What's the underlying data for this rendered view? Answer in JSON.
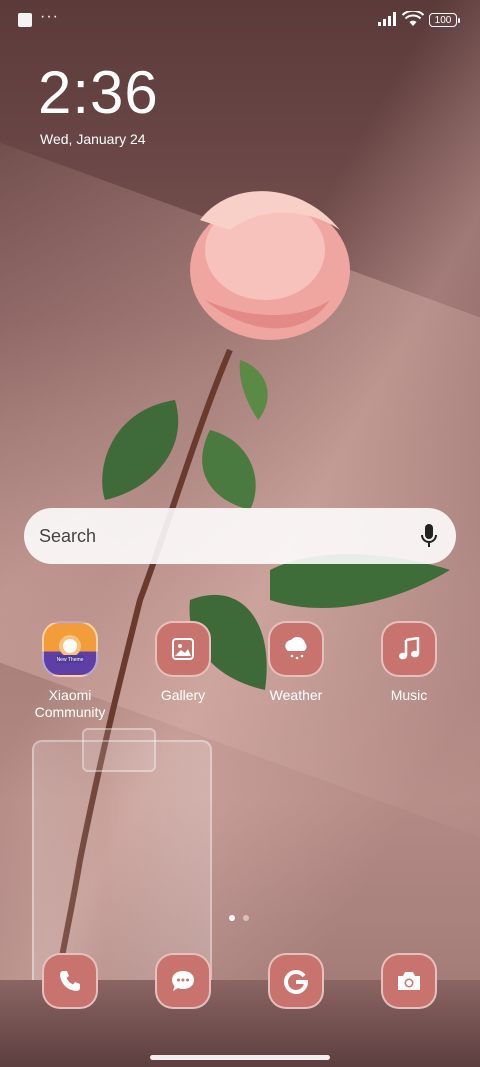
{
  "status": {
    "battery": "100",
    "dots": "···"
  },
  "clock": {
    "time": "2:36",
    "date": "Wed, January 24"
  },
  "search": {
    "placeholder": "Search"
  },
  "apps": [
    {
      "name": "Xiaomi Community",
      "icon": "xiaomi-community-icon"
    },
    {
      "name": "Gallery",
      "icon": "gallery-icon"
    },
    {
      "name": "Weather",
      "icon": "weather-icon"
    },
    {
      "name": "Music",
      "icon": "music-icon"
    }
  ],
  "dock": [
    {
      "icon": "phone-icon"
    },
    {
      "icon": "messages-icon"
    },
    {
      "icon": "google-icon"
    },
    {
      "icon": "camera-icon"
    }
  ],
  "colors": {
    "icon_bg": "#c8736e"
  },
  "community_badge": "New Theme"
}
